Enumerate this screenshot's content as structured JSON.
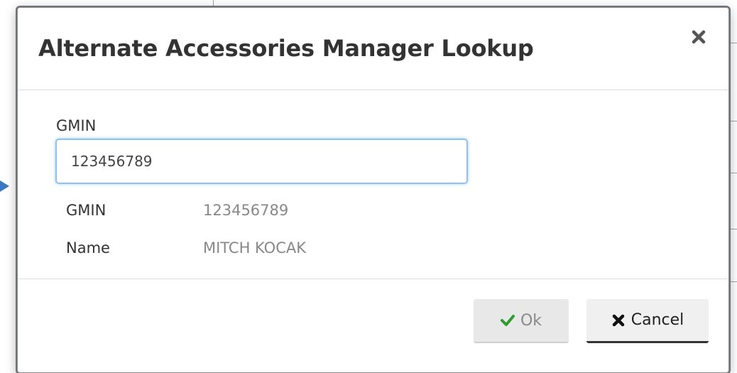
{
  "dialog": {
    "title": "Alternate Accessories Manager Lookup",
    "close_icon": "close-icon"
  },
  "form": {
    "gmin_label": "GMIN",
    "gmin_value": "123456789"
  },
  "details": [
    {
      "label": "GMIN",
      "value": "123456789"
    },
    {
      "label": "Name",
      "value": "MITCH KOCAK"
    }
  ],
  "footer": {
    "ok_label": "Ok",
    "ok_icon": "check-icon",
    "ok_icon_color": "#2e9c2e",
    "cancel_label": "Cancel",
    "cancel_icon": "times-icon"
  }
}
